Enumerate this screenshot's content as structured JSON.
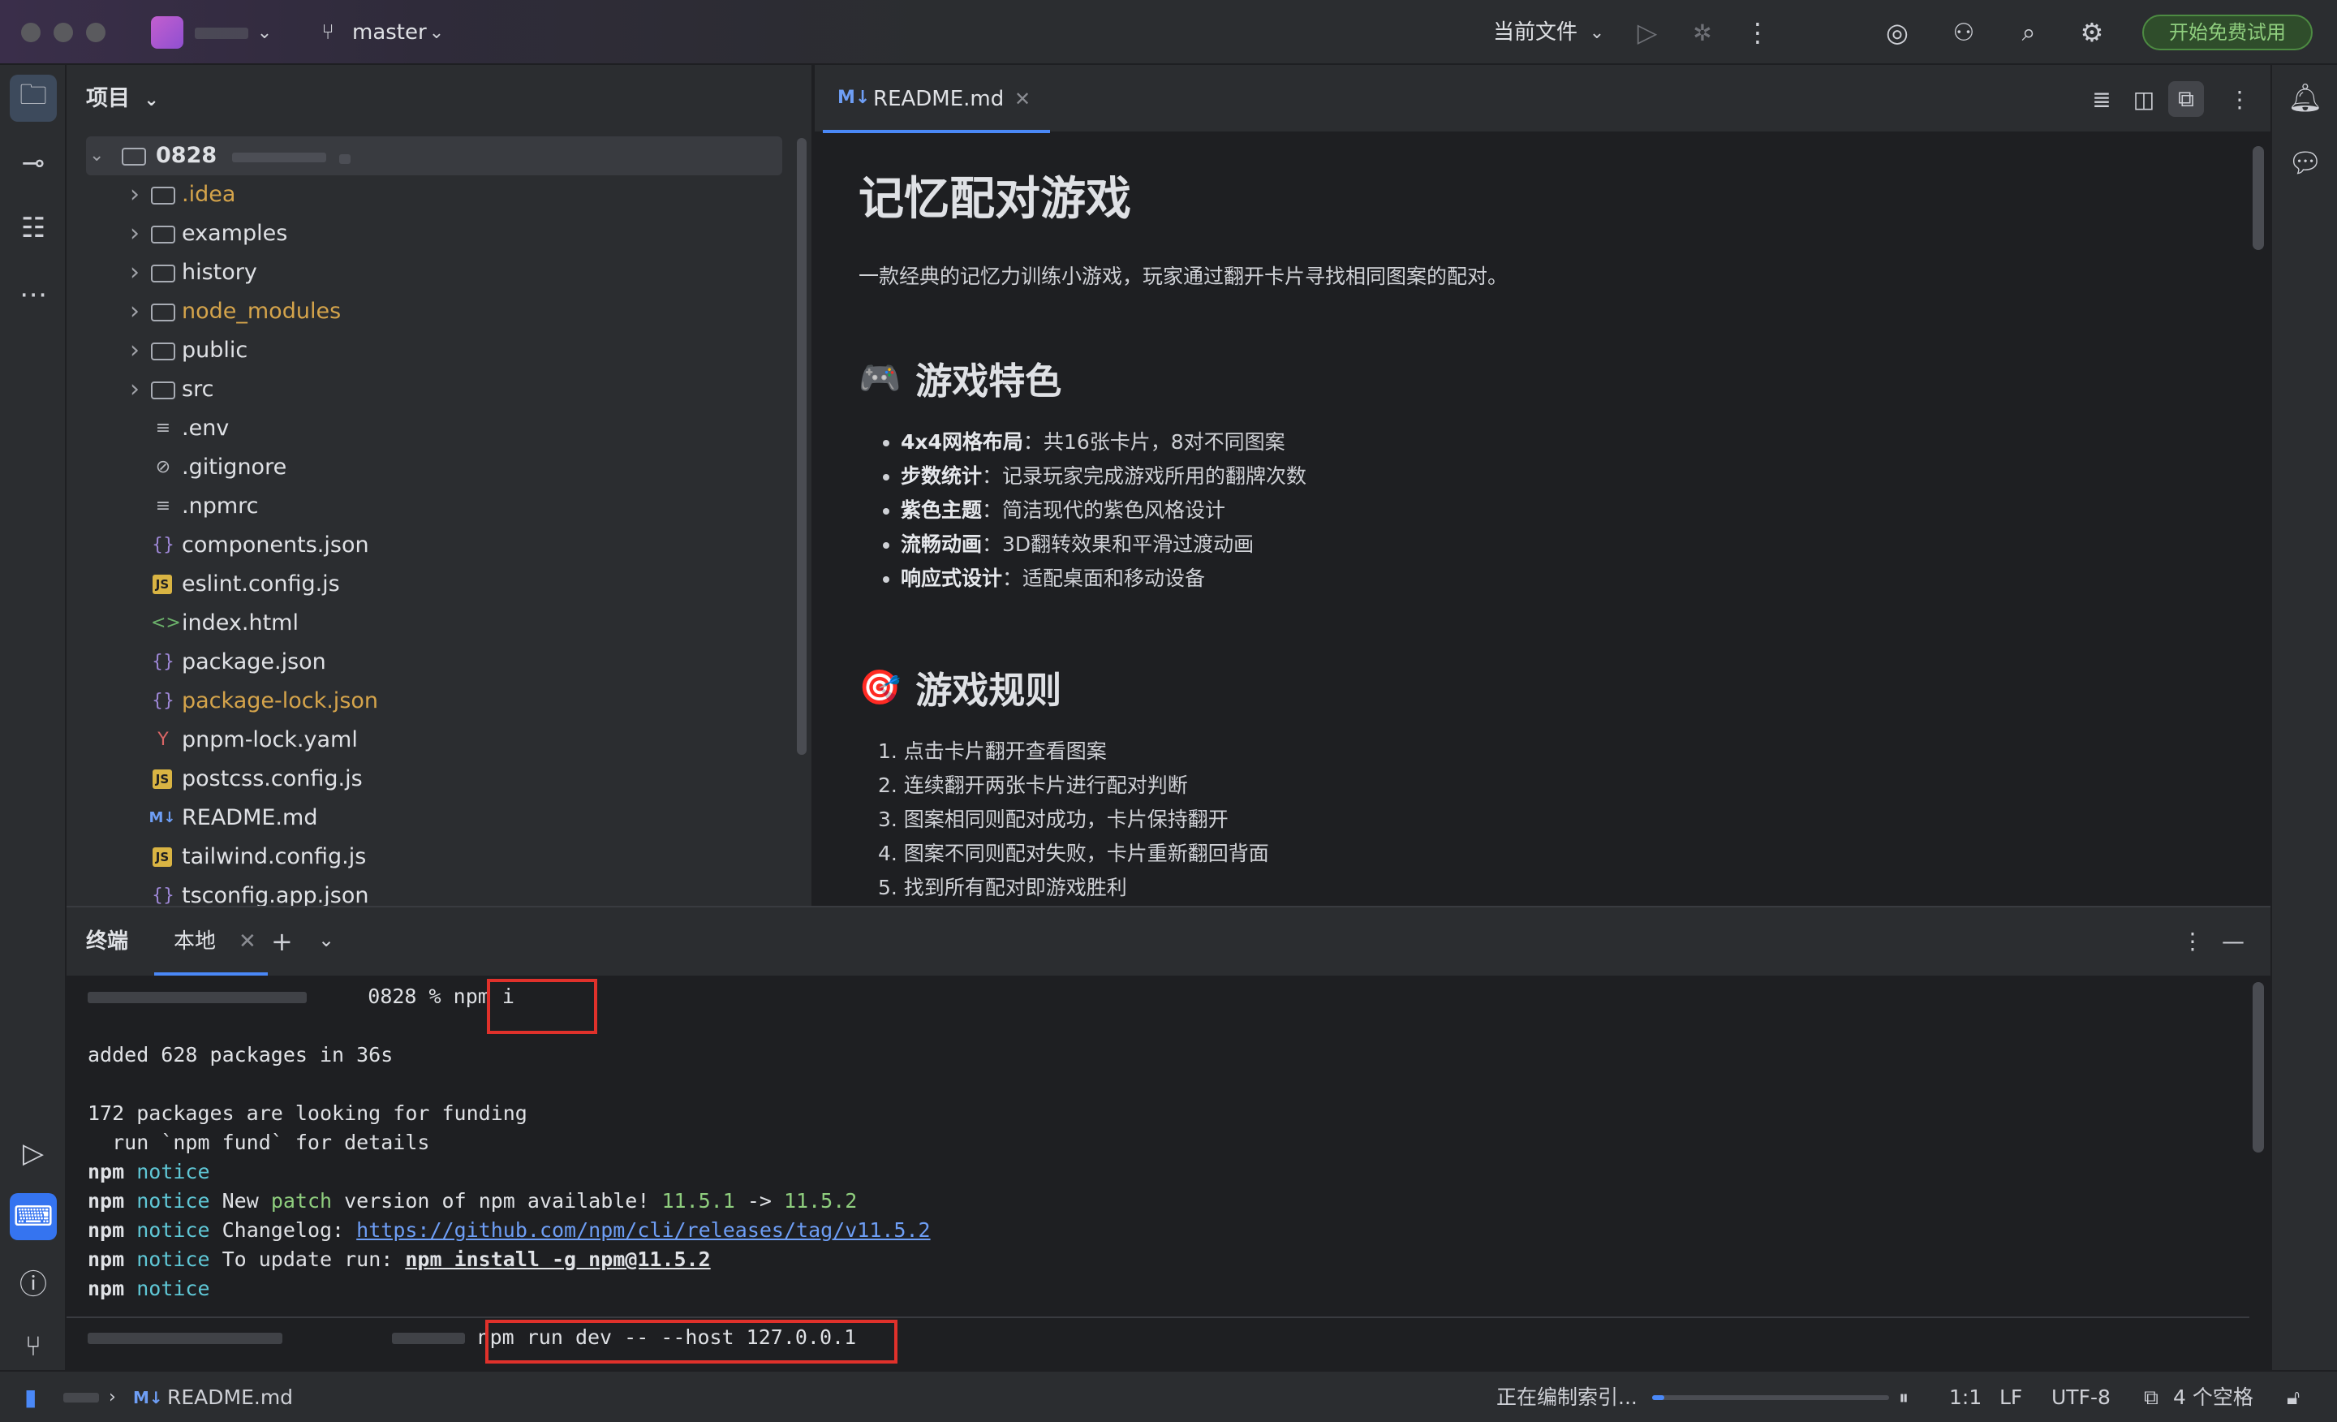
{
  "titlebar": {
    "branch": "master",
    "run_config": "当前文件",
    "trial_button": "开始免费试用"
  },
  "project_panel": {
    "header": "项目",
    "root": "0828",
    "items": [
      {
        "name": ".idea",
        "type": "folder",
        "ignored": true
      },
      {
        "name": "examples",
        "type": "folder"
      },
      {
        "name": "history",
        "type": "folder"
      },
      {
        "name": "node_modules",
        "type": "folder",
        "ignored": true
      },
      {
        "name": "public",
        "type": "folder"
      },
      {
        "name": "src",
        "type": "folder"
      },
      {
        "name": ".env",
        "type": "text"
      },
      {
        "name": ".gitignore",
        "type": "ignore"
      },
      {
        "name": ".npmrc",
        "type": "text"
      },
      {
        "name": "components.json",
        "type": "json"
      },
      {
        "name": "eslint.config.js",
        "type": "js"
      },
      {
        "name": "index.html",
        "type": "html"
      },
      {
        "name": "package.json",
        "type": "json"
      },
      {
        "name": "package-lock.json",
        "type": "json",
        "ignored": true
      },
      {
        "name": "pnpm-lock.yaml",
        "type": "yaml"
      },
      {
        "name": "postcss.config.js",
        "type": "js"
      },
      {
        "name": "README.md",
        "type": "md"
      },
      {
        "name": "tailwind.config.js",
        "type": "js"
      },
      {
        "name": "tsconfig.app.json",
        "type": "json"
      }
    ]
  },
  "editor": {
    "tab_icon": "M↓",
    "tab_label": "README.md",
    "readme": {
      "title": "记忆配对游戏",
      "intro": "一款经典的记忆力训练小游戏，玩家通过翻开卡片寻找相同图案的配对。",
      "features_heading": "游戏特色",
      "features_emoji": "🎮",
      "features": [
        {
          "bold": "4x4网格布局",
          "text": "：共16张卡片，8对不同图案"
        },
        {
          "bold": "步数统计",
          "text": "：记录玩家完成游戏所用的翻牌次数"
        },
        {
          "bold": "紫色主题",
          "text": "：简洁现代的紫色风格设计"
        },
        {
          "bold": "流畅动画",
          "text": "：3D翻转效果和平滑过渡动画"
        },
        {
          "bold": "响应式设计",
          "text": "：适配桌面和移动设备"
        }
      ],
      "rules_heading": "游戏规则",
      "rules_emoji": "🎯",
      "rules": [
        "1. 点击卡片翻开查看图案",
        "2. 连续翻开两张卡片进行配对判断",
        "3. 图案相同则配对成功，卡片保持翻开",
        "4. 图案不同则配对失败，卡片重新翻回背面",
        "5. 找到所有配对即游戏胜利"
      ]
    }
  },
  "terminal": {
    "title": "终端",
    "tab": "本地",
    "prompt_dir": "0828 %",
    "cmd1": "npm i",
    "added": "added 628 packages in 36s",
    "funding1": "172 packages are looking for funding",
    "funding2": "  run `npm fund` for details",
    "npm": "npm",
    "notice": "notice",
    "new_pre": "New ",
    "patch": "patch",
    "new_mid": " version of npm available! ",
    "v_old": "11.5.1",
    "arrow": " -> ",
    "v_new": "11.5.2",
    "changelog": "Changelog: ",
    "changelog_url": "https://github.com/npm/cli/releases/tag/v11.5.2",
    "update": "To update run: ",
    "update_cmd": "npm install -g npm@11.5.2",
    "cmd2": "npm run dev -- --host 127.0.0.1"
  },
  "statusbar": {
    "breadcrumb_icon": "M↓",
    "breadcrumb_file": "README.md",
    "indexing": "正在编制索引...",
    "indexing_progress": 0.05,
    "position": "1:1",
    "line_sep": "LF",
    "encoding": "UTF-8",
    "indent": "4 个空格"
  },
  "colors": {
    "accent": "#4a88f7",
    "ignored_file": "#d5a44b",
    "highlight_box": "#e0312b",
    "trial": "#8fce7e"
  }
}
